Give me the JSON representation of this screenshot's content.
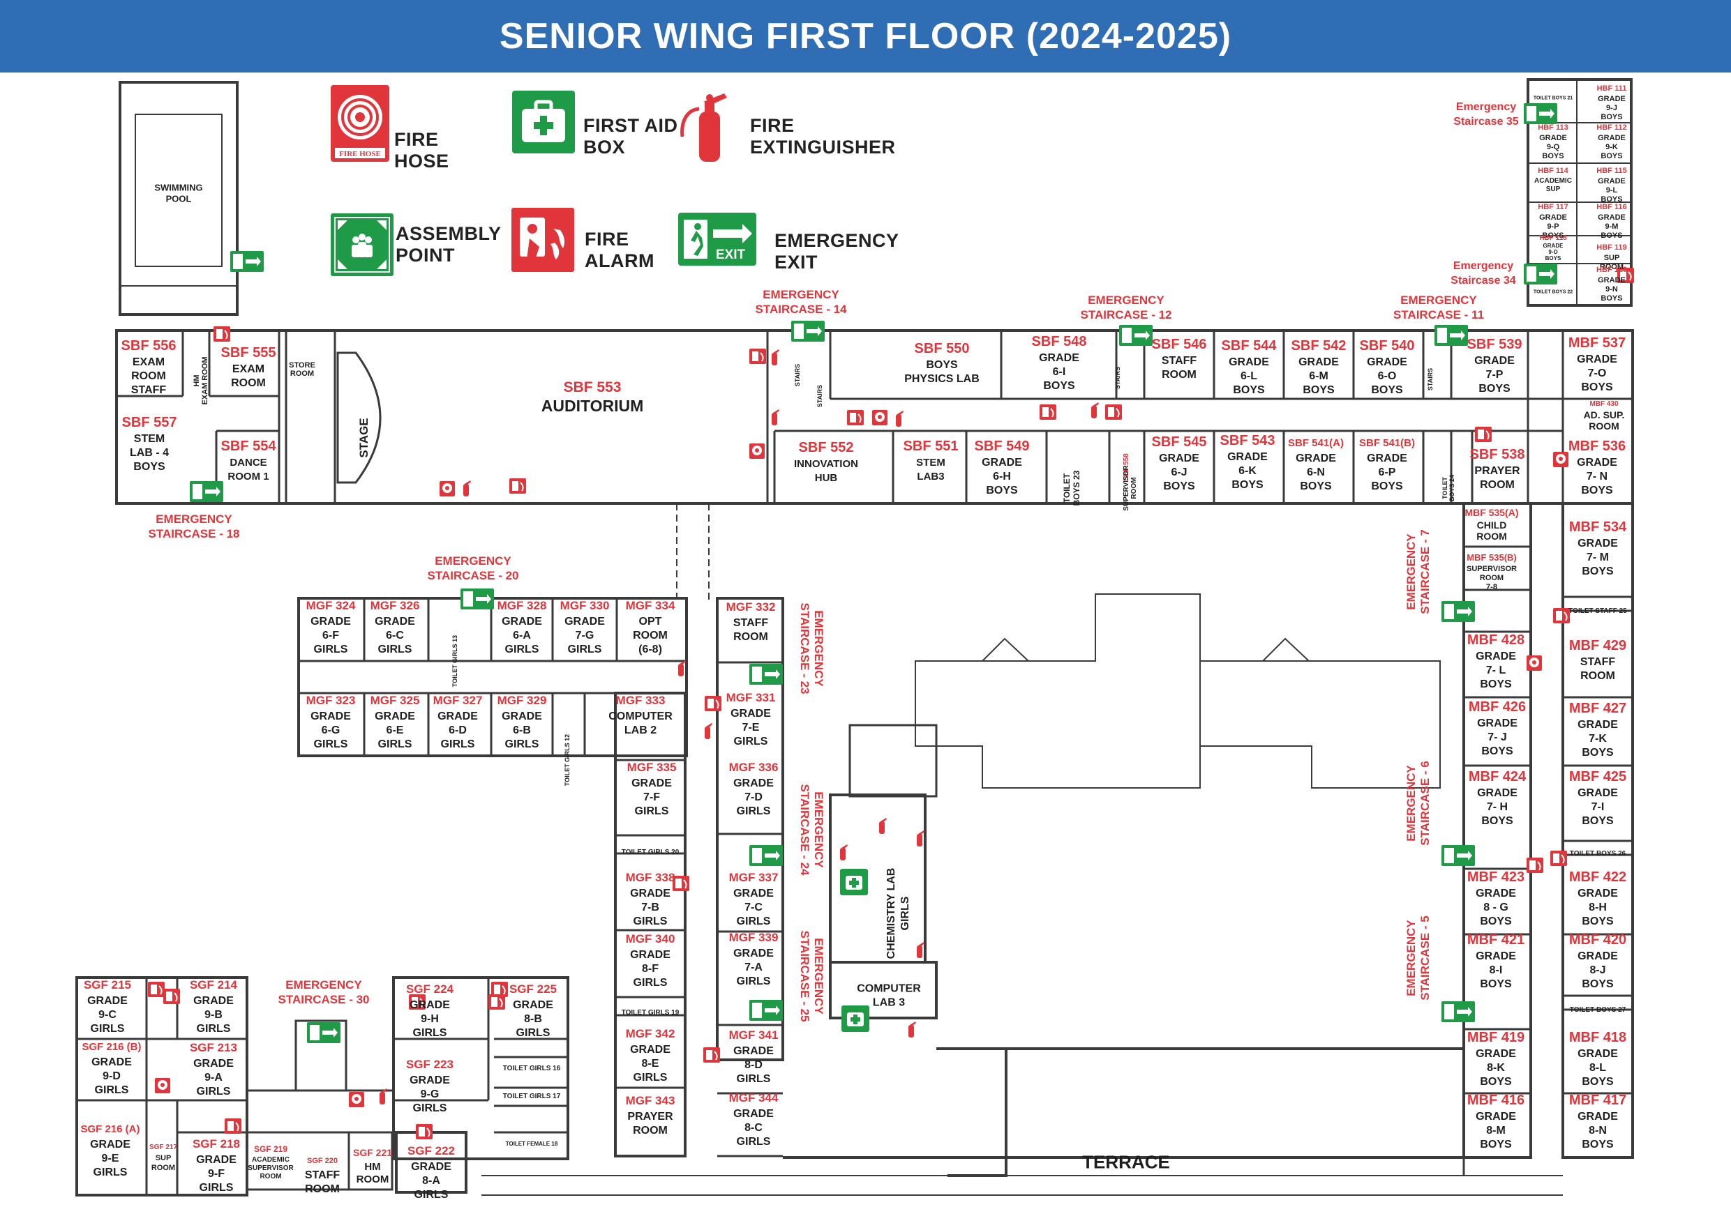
{
  "header": {
    "title": "SENIOR WING FIRST FLOOR (2024-2025)",
    "color": "#2f6db5"
  },
  "colors": {
    "room_code": "#e0353a",
    "room_label": "#1f1f1f",
    "wall": "#3a3a3a",
    "safety_red": "#e0353a",
    "safety_green": "#1f9a46"
  },
  "legend": {
    "fire_hose": {
      "icon": "fire-hose-icon",
      "badge": "FIRE HOSE",
      "label1": "FIRE",
      "label2": "HOSE"
    },
    "first_aid": {
      "icon": "first-aid-icon",
      "label1": "FIRST AID",
      "label2": "BOX"
    },
    "extinguisher": {
      "icon": "fire-extinguisher-icon",
      "label1": "FIRE",
      "label2": "EXTINGUISHER"
    },
    "assembly": {
      "icon": "assembly-point-icon",
      "label1": "ASSEMBLY",
      "label2": "POINT"
    },
    "alarm": {
      "icon": "fire-alarm-icon",
      "label1": "FIRE",
      "label2": "ALARM"
    },
    "exit": {
      "icon": "emergency-exit-icon",
      "badge": "EXIT",
      "label1": "EMERGENCY",
      "label2": "EXIT"
    }
  },
  "exit_badge": "EXIT",
  "map": {
    "rooms": [
      {
        "code": "SBF 556",
        "lines": [
          "EXAM",
          "ROOM",
          "STAFF"
        ]
      },
      {
        "code": "",
        "lines": [
          "HM",
          "EXAM ROOM"
        ]
      },
      {
        "code": "SBF 555",
        "lines": [
          "EXAM",
          "ROOM"
        ]
      },
      {
        "code": "",
        "lines": [
          "STORE",
          "ROOM"
        ]
      },
      {
        "code": "SBF 557",
        "lines": [
          "STEM",
          "LAB - 4",
          "BOYS"
        ]
      },
      {
        "code": "SBF 554",
        "lines": [
          "DANCE",
          "ROOM 1"
        ]
      },
      {
        "code": "",
        "lines": [
          "STAGE"
        ]
      },
      {
        "code": "SBF 553",
        "lines": [
          "AUDITORIUM"
        ]
      },
      {
        "code": "SBF 550",
        "lines": [
          "BOYS",
          "PHYSICS LAB"
        ]
      },
      {
        "code": "",
        "lines": [
          "STAIRS"
        ]
      },
      {
        "code": "SBF 548",
        "lines": [
          "GRADE",
          "6-I",
          "BOYS"
        ]
      },
      {
        "code": "SBF 546",
        "lines": [
          "STAFF",
          "ROOM"
        ]
      },
      {
        "code": "SBF 544",
        "lines": [
          "GRADE",
          "6-L",
          "BOYS"
        ]
      },
      {
        "code": "SBF 542",
        "lines": [
          "GRADE",
          "6-M",
          "BOYS"
        ]
      },
      {
        "code": "SBF 540",
        "lines": [
          "GRADE",
          "6-O",
          "BOYS"
        ]
      },
      {
        "code": "SBF 539",
        "lines": [
          "GRADE",
          "7-P",
          "BOYS"
        ]
      },
      {
        "code": "MBF 537",
        "lines": [
          "GRADE",
          "7-O",
          "BOYS"
        ]
      },
      {
        "code": "MBF 430",
        "lines": [
          "AD. SUP.",
          "ROOM"
        ]
      },
      {
        "code": "SBF 552",
        "lines": [
          "INNOVATION",
          "HUB"
        ]
      },
      {
        "code": "SBF 551",
        "lines": [
          "STEM",
          "LAB3"
        ]
      },
      {
        "code": "SBF 549",
        "lines": [
          "GRADE",
          "6-H",
          "BOYS"
        ]
      },
      {
        "code": "",
        "lines": [
          "TOILET",
          "BOYS 23"
        ]
      },
      {
        "code": "SBF 558",
        "lines": [
          "SUPERVISOR",
          "ROOM"
        ]
      },
      {
        "code": "SBF 545",
        "lines": [
          "GRADE",
          "6-J",
          "BOYS"
        ]
      },
      {
        "code": "SBF 543",
        "lines": [
          "GRADE",
          "6-K",
          "BOYS"
        ]
      },
      {
        "code": "SBF 541(A)",
        "lines": [
          "GRADE",
          "6-N",
          "BOYS"
        ]
      },
      {
        "code": "SBF 541(B)",
        "lines": [
          "GRADE",
          "6-P",
          "BOYS"
        ]
      },
      {
        "code": "",
        "lines": [
          "TOILET",
          "BOYS 24"
        ]
      },
      {
        "code": "SBF 538",
        "lines": [
          "PRAYER",
          "ROOM"
        ]
      },
      {
        "code": "MBF 536",
        "lines": [
          "GRADE",
          "7- N",
          "BOYS"
        ]
      },
      {
        "code": "MBF 535(A)",
        "lines": [
          "CHILD",
          "ROOM"
        ]
      },
      {
        "code": "MBF 535(B)",
        "lines": [
          "SUPERVISOR",
          "ROOM",
          "7-8"
        ]
      },
      {
        "code": "MBF 534",
        "lines": [
          "GRADE",
          "7- M",
          "BOYS"
        ]
      },
      {
        "code": "",
        "lines": [
          "TOILET STAFF 25"
        ]
      },
      {
        "code": "MBF 428",
        "lines": [
          "GRADE",
          "7- L",
          "BOYS"
        ]
      },
      {
        "code": "MBF 429",
        "lines": [
          "STAFF",
          "ROOM"
        ]
      },
      {
        "code": "MBF 426",
        "lines": [
          "GRADE",
          "7- J",
          "BOYS"
        ]
      },
      {
        "code": "MBF 427",
        "lines": [
          "GRADE",
          "7-K",
          "BOYS"
        ]
      },
      {
        "code": "MBF 424",
        "lines": [
          "GRADE",
          "7- H",
          "BOYS"
        ]
      },
      {
        "code": "MBF 425",
        "lines": [
          "GRADE",
          "7-I",
          "BOYS"
        ]
      },
      {
        "code": "",
        "lines": [
          "TOILET BOYS 26"
        ]
      },
      {
        "code": "MBF 423",
        "lines": [
          "GRADE",
          "8 - G",
          "BOYS"
        ]
      },
      {
        "code": "MBF 422",
        "lines": [
          "GRADE",
          "8-H",
          "BOYS"
        ]
      },
      {
        "code": "MBF 421",
        "lines": [
          "GRADE",
          "8-I",
          "BOYS"
        ]
      },
      {
        "code": "MBF 420",
        "lines": [
          "GRADE",
          "8-J",
          "BOYS"
        ]
      },
      {
        "code": "",
        "lines": [
          "TOILET BOYS 27"
        ]
      },
      {
        "code": "MBF 419",
        "lines": [
          "GRADE",
          "8-K",
          "BOYS"
        ]
      },
      {
        "code": "MBF 418",
        "lines": [
          "GRADE",
          "8-L",
          "BOYS"
        ]
      },
      {
        "code": "MBF 416",
        "lines": [
          "GRADE",
          "8-M",
          "BOYS"
        ]
      },
      {
        "code": "MBF 417",
        "lines": [
          "GRADE",
          "8-N",
          "BOYS"
        ]
      },
      {
        "code": "MGF 324",
        "lines": [
          "GRADE",
          "6-F",
          "GIRLS"
        ]
      },
      {
        "code": "MGF 326",
        "lines": [
          "GRADE",
          "6-C",
          "GIRLS"
        ]
      },
      {
        "code": "",
        "lines": [
          "TOILET GIRLS 13"
        ]
      },
      {
        "code": "MGF 328",
        "lines": [
          "GRADE",
          "6-A",
          "GIRLS"
        ]
      },
      {
        "code": "MGF 330",
        "lines": [
          "GRADE",
          "7-G",
          "GIRLS"
        ]
      },
      {
        "code": "MGF 334",
        "lines": [
          "OPT",
          "ROOM",
          "(6-8)"
        ]
      },
      {
        "code": "MGF 332",
        "lines": [
          "STAFF",
          "ROOM"
        ]
      },
      {
        "code": "MGF 323",
        "lines": [
          "GRADE",
          "6-G",
          "GIRLS"
        ]
      },
      {
        "code": "MGF 325",
        "lines": [
          "GRADE",
          "6-E",
          "GIRLS"
        ]
      },
      {
        "code": "MGF 327",
        "lines": [
          "GRADE",
          "6-D",
          "GIRLS"
        ]
      },
      {
        "code": "MGF 329",
        "lines": [
          "GRADE",
          "6-B",
          "GIRLS"
        ]
      },
      {
        "code": "",
        "lines": [
          "TOILET GIRLS 12"
        ]
      },
      {
        "code": "MGF 333",
        "lines": [
          "COMPUTER",
          "LAB 2"
        ]
      },
      {
        "code": "MGF 331",
        "lines": [
          "GRADE",
          "7-E",
          "GIRLS"
        ]
      },
      {
        "code": "MGF 335",
        "lines": [
          "GRADE",
          "7-F",
          "GIRLS"
        ]
      },
      {
        "code": "MGF 336",
        "lines": [
          "GRADE",
          "7-D",
          "GIRLS"
        ]
      },
      {
        "code": "",
        "lines": [
          "TOILET GIRLS 20"
        ]
      },
      {
        "code": "MGF 338",
        "lines": [
          "GRADE",
          "7-B",
          "GIRLS"
        ]
      },
      {
        "code": "MGF 337",
        "lines": [
          "GRADE",
          "7-C",
          "GIRLS"
        ]
      },
      {
        "code": "MGF 340",
        "lines": [
          "GRADE",
          "8-F",
          "GIRLS"
        ]
      },
      {
        "code": "MGF 339",
        "lines": [
          "GRADE",
          "7-A",
          "GIRLS"
        ]
      },
      {
        "code": "",
        "lines": [
          "TOILET GIRLS 19"
        ]
      },
      {
        "code": "MGF 342",
        "lines": [
          "GRADE",
          "8-E",
          "GIRLS"
        ]
      },
      {
        "code": "MGF 341",
        "lines": [
          "GRADE",
          "8-D",
          "GIRLS"
        ]
      },
      {
        "code": "MGF 343",
        "lines": [
          "PRAYER",
          "ROOM"
        ]
      },
      {
        "code": "MGF 344",
        "lines": [
          "GRADE",
          "8-C",
          "GIRLS"
        ]
      },
      {
        "code": "",
        "lines": [
          "CHEMISTRY LAB",
          "GIRLS"
        ]
      },
      {
        "code": "",
        "lines": [
          "COMPUTER",
          "LAB 3"
        ]
      },
      {
        "code": "SGF 215",
        "lines": [
          "GRADE",
          "9-C",
          "GIRLS"
        ]
      },
      {
        "code": "SGF 214",
        "lines": [
          "GRADE",
          "9-B",
          "GIRLS"
        ]
      },
      {
        "code": "SGF 216 (B)",
        "lines": [
          "GRADE",
          "9-D",
          "GIRLS"
        ]
      },
      {
        "code": "SGF 213",
        "lines": [
          "GRADE",
          "9-A",
          "GIRLS"
        ]
      },
      {
        "code": "SGF 216 (A)",
        "lines": [
          "GRADE",
          "9-E",
          "GIRLS"
        ]
      },
      {
        "code": "SGF 217",
        "lines": [
          "SUP",
          "ROOM"
        ]
      },
      {
        "code": "SGF 218",
        "lines": [
          "GRADE",
          "9-F",
          "GIRLS"
        ]
      },
      {
        "code": "SGF 219",
        "lines": [
          "ACADEMIC",
          "SUPERVISOR",
          "ROOM"
        ]
      },
      {
        "code": "SGF 220",
        "lines": [
          "STAFF",
          "ROOM"
        ]
      },
      {
        "code": "SGF 221",
        "lines": [
          "HM",
          "ROOM"
        ]
      },
      {
        "code": "SGF 224",
        "lines": [
          "GRADE",
          "9-H",
          "GIRLS"
        ]
      },
      {
        "code": "SGF 225",
        "lines": [
          "GRADE",
          "8-B",
          "GIRLS"
        ]
      },
      {
        "code": "SGF 223",
        "lines": [
          "GRADE",
          "9-G",
          "GIRLS"
        ]
      },
      {
        "code": "",
        "lines": [
          "TOILET GIRLS 16"
        ]
      },
      {
        "code": "",
        "lines": [
          "TOILET GIRLS 17"
        ]
      },
      {
        "code": "",
        "lines": [
          "TOILET FEMALE 18"
        ]
      },
      {
        "code": "SGF 222",
        "lines": [
          "GRADE",
          "8-A",
          "GIRLS"
        ]
      },
      {
        "code": "",
        "lines": [
          "SWIMMING",
          "POOL"
        ]
      },
      {
        "code": "HBF 111",
        "lines": [
          "GRADE",
          "9-J",
          "BOYS"
        ]
      },
      {
        "code": "",
        "lines": [
          "TOILET BOYS 21"
        ]
      },
      {
        "code": "HBF 113",
        "lines": [
          "GRADE",
          "9-Q",
          "BOYS"
        ]
      },
      {
        "code": "HBF 112",
        "lines": [
          "GRADE",
          "9-K",
          "BOYS"
        ]
      },
      {
        "code": "HBF 114",
        "lines": [
          "ACADEMIC",
          "SUP"
        ]
      },
      {
        "code": "HBF 115",
        "lines": [
          "GRADE",
          "9-L",
          "BOYS"
        ]
      },
      {
        "code": "HBF 117",
        "lines": [
          "GRADE",
          "9-P",
          "BOYS"
        ]
      },
      {
        "code": "HBF 116",
        "lines": [
          "GRADE",
          "9-M",
          "BOYS"
        ]
      },
      {
        "code": "HBF 118",
        "lines": [
          "GRADE",
          "9-O",
          "BOYS"
        ]
      },
      {
        "code": "HBF 119",
        "lines": [
          "SUP",
          "ROOM"
        ]
      },
      {
        "code": "HBF 120",
        "lines": [
          "GRADE",
          "9-N",
          "BOYS"
        ]
      },
      {
        "code": "",
        "lines": [
          "TOILET BOYS 22"
        ]
      },
      {
        "code": "",
        "lines": [
          "TERRACE"
        ]
      }
    ],
    "staircases": [
      [
        "EMERGENCY",
        "STAIRCASE - 14"
      ],
      [
        "EMERGENCY",
        "STAIRCASE - 12"
      ],
      [
        "EMERGENCY",
        "STAIRCASE - 11"
      ],
      [
        "Emergency",
        "Staircase 35"
      ],
      [
        "Emergency",
        "Staircase 34"
      ],
      [
        "EMERGENCY",
        "STAIRCASE - 18"
      ],
      [
        "EMERGENCY",
        "STAIRCASE - 20"
      ],
      [
        "EMERGENCY",
        "STAIRCASE - 23"
      ],
      [
        "EMERGENCY",
        "STAIRCASE - 24"
      ],
      [
        "EMERGENCY",
        "STAIRCASE - 25"
      ],
      [
        "EMERGENCY",
        "STAIRCASE - 7"
      ],
      [
        "EMERGENCY",
        "STAIRCASE - 6"
      ],
      [
        "EMERGENCY",
        "STAIRCASE - 5"
      ],
      [
        "EMERGENCY",
        "STAIRCASE - 30"
      ]
    ],
    "stairs_labels": [
      "STAIRS",
      "STAIRS",
      "STAIRS"
    ]
  }
}
